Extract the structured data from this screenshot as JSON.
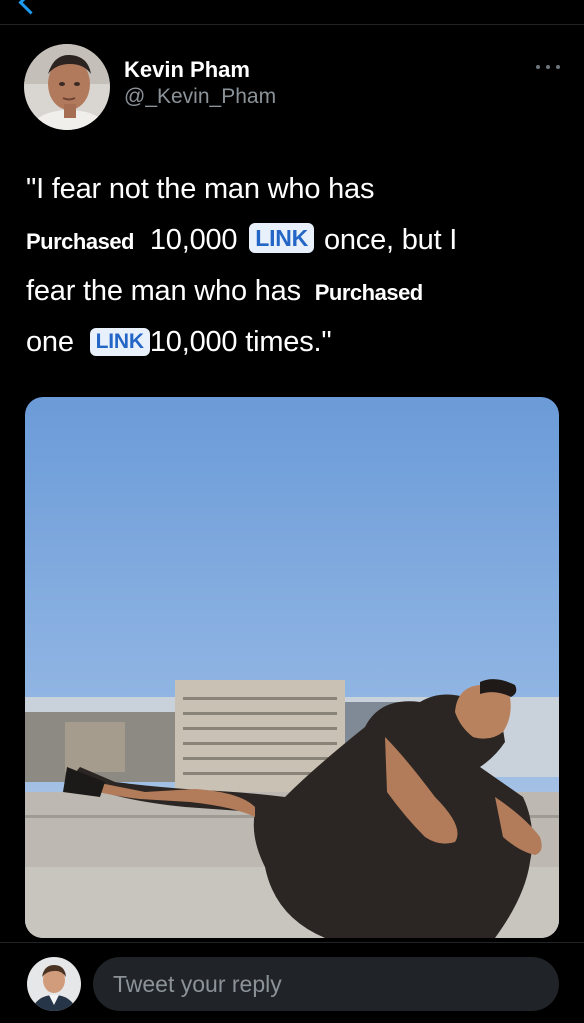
{
  "user": {
    "display_name": "Kevin Pham",
    "handle": "@_Kevin_Pham"
  },
  "tweet": {
    "line1": "\"I fear not the man who has",
    "bold_word": "Purchased",
    "count_a": "10,000",
    "link_label": "LINK",
    "once": "once, but I",
    "line3_start": "fear the man who has",
    "line4_one": "one",
    "line4_end": "10,000 times.\""
  },
  "reply": {
    "placeholder": "Tweet your reply"
  },
  "icons": {
    "back": "back-arrow-icon",
    "more": "more-options-icon"
  },
  "colors": {
    "background": "#000000",
    "link_badge_bg": "#e8f0fb",
    "link_badge_text": "#2466c6",
    "accent": "#1d9bf0"
  }
}
